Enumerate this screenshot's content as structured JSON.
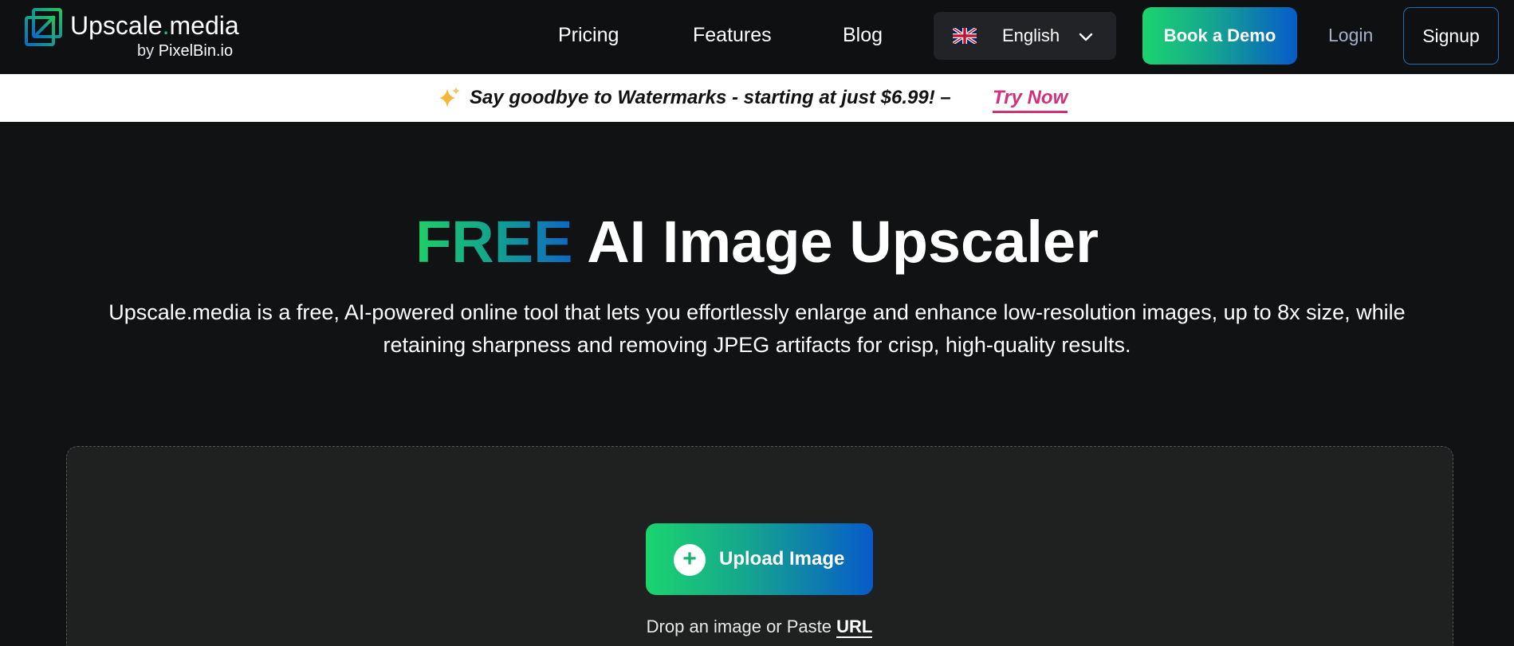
{
  "header": {
    "brand_name": "Upscale",
    "brand_dot": ".",
    "brand_suffix": "media",
    "brand_by": "by",
    "brand_company": "PixelBin.io",
    "nav": [
      {
        "label": "Pricing"
      },
      {
        "label": "Features"
      },
      {
        "label": "Blog"
      }
    ],
    "language": {
      "label": "English",
      "flag_icon": "uk-flag-icon"
    },
    "demo_label": "Book a Demo",
    "login_label": "Login",
    "signup_label": "Signup"
  },
  "promo": {
    "text": "Say goodbye to Watermarks - starting at just $6.99! –",
    "link_label": "Try Now",
    "icon": "sparkle-icon"
  },
  "hero": {
    "title_highlight": "FREE",
    "title_rest": " AI Image Upscaler",
    "description": "Upscale.media is a free, AI-powered online tool that lets you effortlessly enlarge and enhance low-resolution images, up to 8x size, while retaining sharpness and removing JPEG artifacts for crisp, high-quality results."
  },
  "upload": {
    "button_label": "Upload Image",
    "drop_text": "Drop an image or Paste ",
    "url_label": "URL"
  },
  "colors": {
    "accent_green": "#1bd46e",
    "accent_blue": "#075bc9",
    "promo_link": "#d1307a",
    "background": "#111214"
  }
}
